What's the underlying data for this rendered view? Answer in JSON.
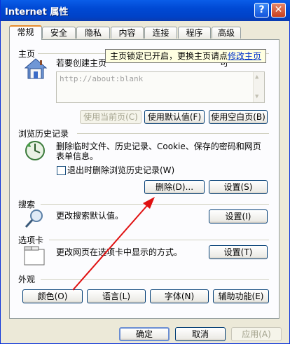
{
  "window": {
    "title": "Internet 属性",
    "help_glyph": "?",
    "close_glyph": "✕"
  },
  "tabs": [
    {
      "label": "常规",
      "active": true
    },
    {
      "label": "安全"
    },
    {
      "label": "隐私"
    },
    {
      "label": "内容"
    },
    {
      "label": "连接"
    },
    {
      "label": "程序"
    },
    {
      "label": "高级"
    }
  ],
  "home": {
    "label": "主页",
    "desc_line1": "若要创建主页",
    "desc_line2": "可",
    "url": "http://about:blank",
    "tooltip_text": "主页锁定已开启，更换主页请点",
    "tooltip_link": "修改主页",
    "btn_current": "使用当前页(C)",
    "btn_default": "使用默认值(F)",
    "btn_blank": "使用空白页(B)"
  },
  "history": {
    "label": "浏览历史记录",
    "desc": "删除临时文件、历史记录、Cookie、保存的密码和网页表单信息。",
    "desc_line1": "删除临时文件、历史记录、Cookie、保存的密码和网页",
    "desc_line2": "表单信息。",
    "checkbox_label": "退出时删除浏览历史记录(W)",
    "btn_delete": "删除(D)...",
    "btn_settings": "设置(S)"
  },
  "search": {
    "label": "搜索",
    "desc": "更改搜索默认值。",
    "btn_settings": "设置(I)"
  },
  "tabs_section": {
    "label": "选项卡",
    "desc": "更改网页在选项卡中显示的方式。",
    "btn_settings": "设置(T)"
  },
  "appearance": {
    "label": "外观",
    "btn_colors": "颜色(O)",
    "btn_languages": "语言(L)",
    "btn_fonts": "字体(N)",
    "btn_accessibility": "辅助功能(E)"
  },
  "footer": {
    "ok": "确定",
    "cancel": "取消",
    "apply": "应用(A)"
  },
  "colors": {
    "titlebar": "#0054e3",
    "dialog_bg": "#ece9d8",
    "annotation_arrow": "#e01010"
  }
}
